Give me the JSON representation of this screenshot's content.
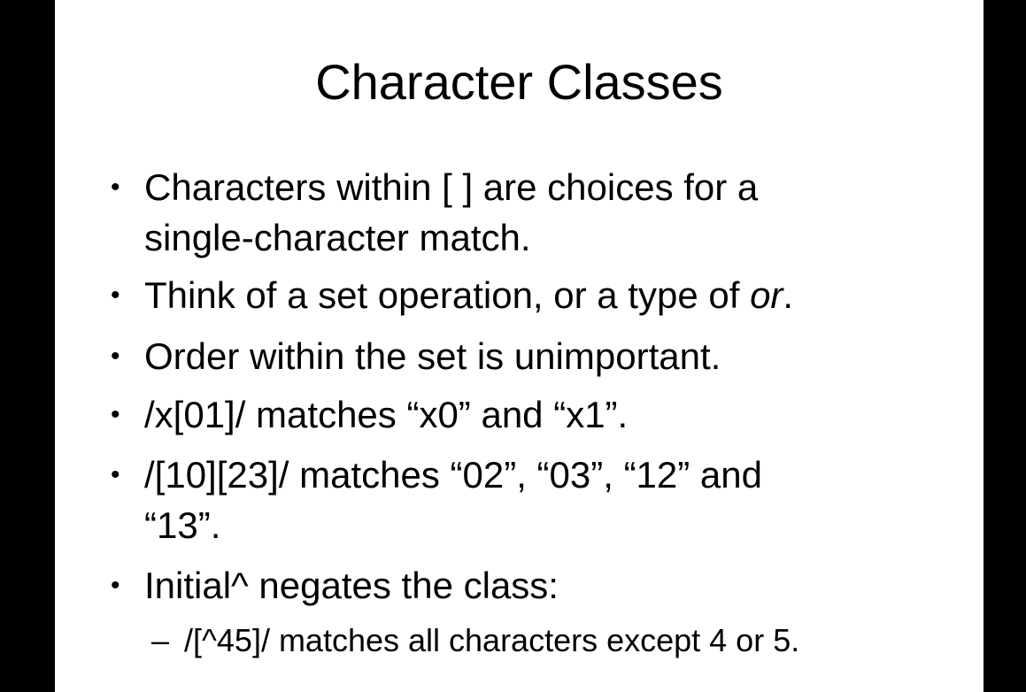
{
  "slide": {
    "title": "Character Classes",
    "bullets": [
      {
        "lines": [
          "Characters within [ ] are choices for a",
          "single-character match."
        ]
      },
      {
        "pre": "Think of a set operation, or a type of ",
        "em": "or",
        "post": "."
      },
      {
        "lines": [
          "Order within the set is unimportant."
        ]
      },
      {
        "lines": [
          "/x[01]/ matches “x0” and “x1”."
        ]
      },
      {
        "lines": [
          "/[10][23]/ matches “02”, “03”, “12” and",
          "“13”."
        ]
      },
      {
        "lines": [
          "Initial^ negates the class:"
        ]
      }
    ],
    "sub_bullets": [
      {
        "marker": "–",
        "text": "/[^45]/ matches all characters except 4 or 5."
      }
    ],
    "bullet_marker": "•"
  }
}
